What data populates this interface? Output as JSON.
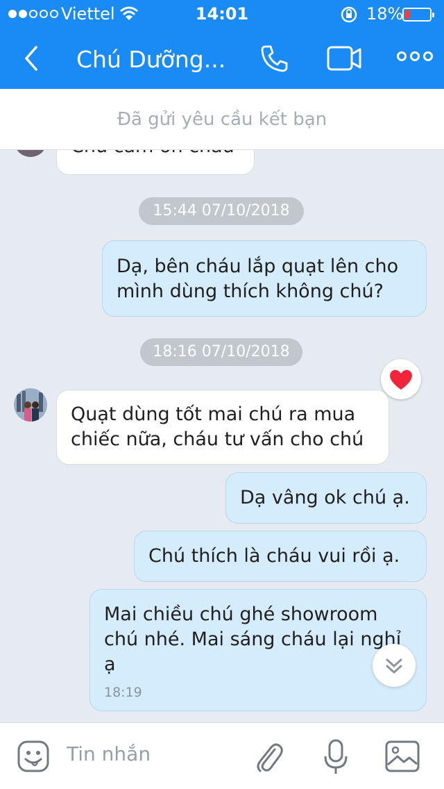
{
  "status_bar": {
    "carrier": "Viettel",
    "time": "14:01",
    "battery": "18%",
    "battery_level": 0.18,
    "signal_bars": 2,
    "icons": [
      "wifi-icon",
      "rotation-lock-icon",
      "battery-icon"
    ]
  },
  "header": {
    "title": "Chú Dưỡng...",
    "icons": [
      "back-arrow-icon",
      "phone-icon",
      "video-call-icon",
      "more-icon"
    ],
    "color": "#1a8af5"
  },
  "friend_request": {
    "text": "Đã gửi yêu cầu kết bạn"
  },
  "messages": {
    "partial_in": "Chú cảm ơn cháu",
    "stamp1": "15:44 07/10/2018",
    "out1_line1": "Dạ, bên cháu lắp quạt lên cho",
    "out1_line2": "mình dùng thích không chú?",
    "stamp2": "18:16 07/10/2018",
    "in1_line1": "Quạt dùng tốt mai chú ra mua",
    "in1_line2": "chiếc nữa, cháu tư vấn cho chú",
    "in1_reaction": "heart-icon",
    "out2": "Dạ vâng ok chú ạ.",
    "out3": "Chú thích là cháu vui rồi ạ.",
    "out4_line1": "Mai chiều chú ghé showroom",
    "out4_line2": "chú nhé. Mai sáng cháu lại nghỉ",
    "out4_line3": "ạ",
    "out4_time": "18:19"
  },
  "composer": {
    "placeholder": "Tin nhắn",
    "icons": [
      "sticker-icon",
      "attachment-icon",
      "microphone-icon",
      "image-icon"
    ]
  },
  "colors": {
    "outgoing_bubble": "#d5ecfc",
    "incoming_bubble": "#ffffff",
    "background": "#e6ebf1",
    "reaction": "#f0243b"
  }
}
